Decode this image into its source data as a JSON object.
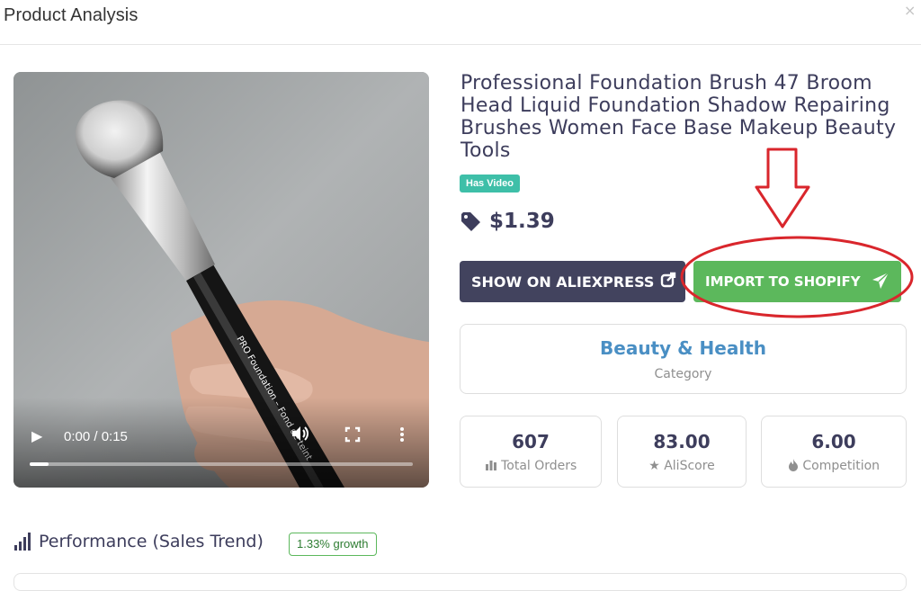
{
  "modal": {
    "title": "Product Analysis",
    "close_label": "×"
  },
  "video": {
    "time_display": "0:00 / 0:15",
    "progress": 0.0,
    "handle_text": "PRO Foundation – Fond de teint"
  },
  "product": {
    "title": "Professional Foundation Brush 47 Broom Head Liquid Foundation Shadow Repairing Brushes Women Face Base Makeup Beauty Tools",
    "badge": "Has Video",
    "price": "$1.39"
  },
  "actions": {
    "show_on_aliexpress": "SHOW ON ALIEXPRESS",
    "import_to_shopify": "IMPORT TO SHOPIFY"
  },
  "category": {
    "value": "Beauty & Health",
    "label": "Category"
  },
  "stats": {
    "orders": {
      "value": "607",
      "label": "Total Orders"
    },
    "aliscore": {
      "value": "83.00",
      "label": "AliScore"
    },
    "competition": {
      "value": "6.00",
      "label": "Competition"
    }
  },
  "performance": {
    "title": "Performance (Sales Trend)",
    "growth": "1.33% growth"
  },
  "colors": {
    "aliexpress_button": "#42435e",
    "shopify_button": "#5cb85c",
    "badge": "#3ebfa8",
    "category": "#4a8fc4",
    "annotation": "#d9262c"
  },
  "icons": {
    "price": "tag-icon",
    "external": "external-link-icon",
    "send": "paper-plane-icon",
    "orders": "bar-chart-icon",
    "aliscore": "star-icon",
    "competition": "fire-icon",
    "performance": "signal-bars-icon"
  }
}
